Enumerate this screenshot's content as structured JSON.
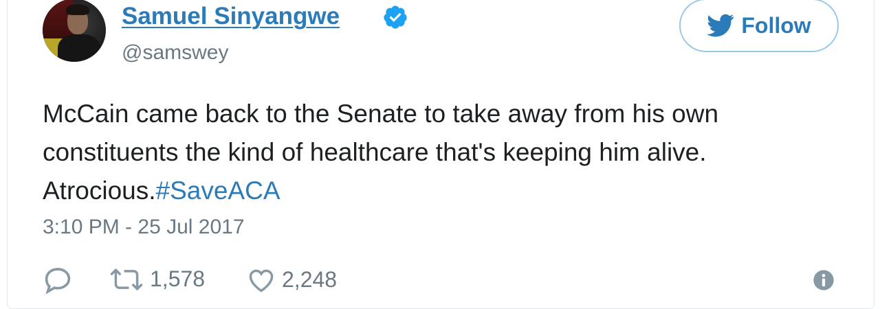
{
  "author": {
    "name": "Samuel Sinyangwe",
    "handle": "@samswey",
    "verified_icon": "verified-badge-icon"
  },
  "follow_button": {
    "label": "Follow",
    "icon": "twitter-bird-icon"
  },
  "tweet": {
    "text": "McCain came back to the Senate to take away from his own constituents the kind of healthcare that's keeping him alive. Atrocious.",
    "hashtag": "#SaveACA",
    "timestamp": "3:10 PM - 25 Jul 2017"
  },
  "actions": {
    "reply_icon": "reply-icon",
    "retweet_icon": "retweet-icon",
    "retweet_count": "1,578",
    "like_icon": "heart-icon",
    "like_count": "2,248",
    "info_icon": "info-icon"
  },
  "colors": {
    "link_blue": "#2b7bb9",
    "text_dark": "#1c2022",
    "text_gray": "#697882",
    "follow_border": "#9bc7e6"
  }
}
